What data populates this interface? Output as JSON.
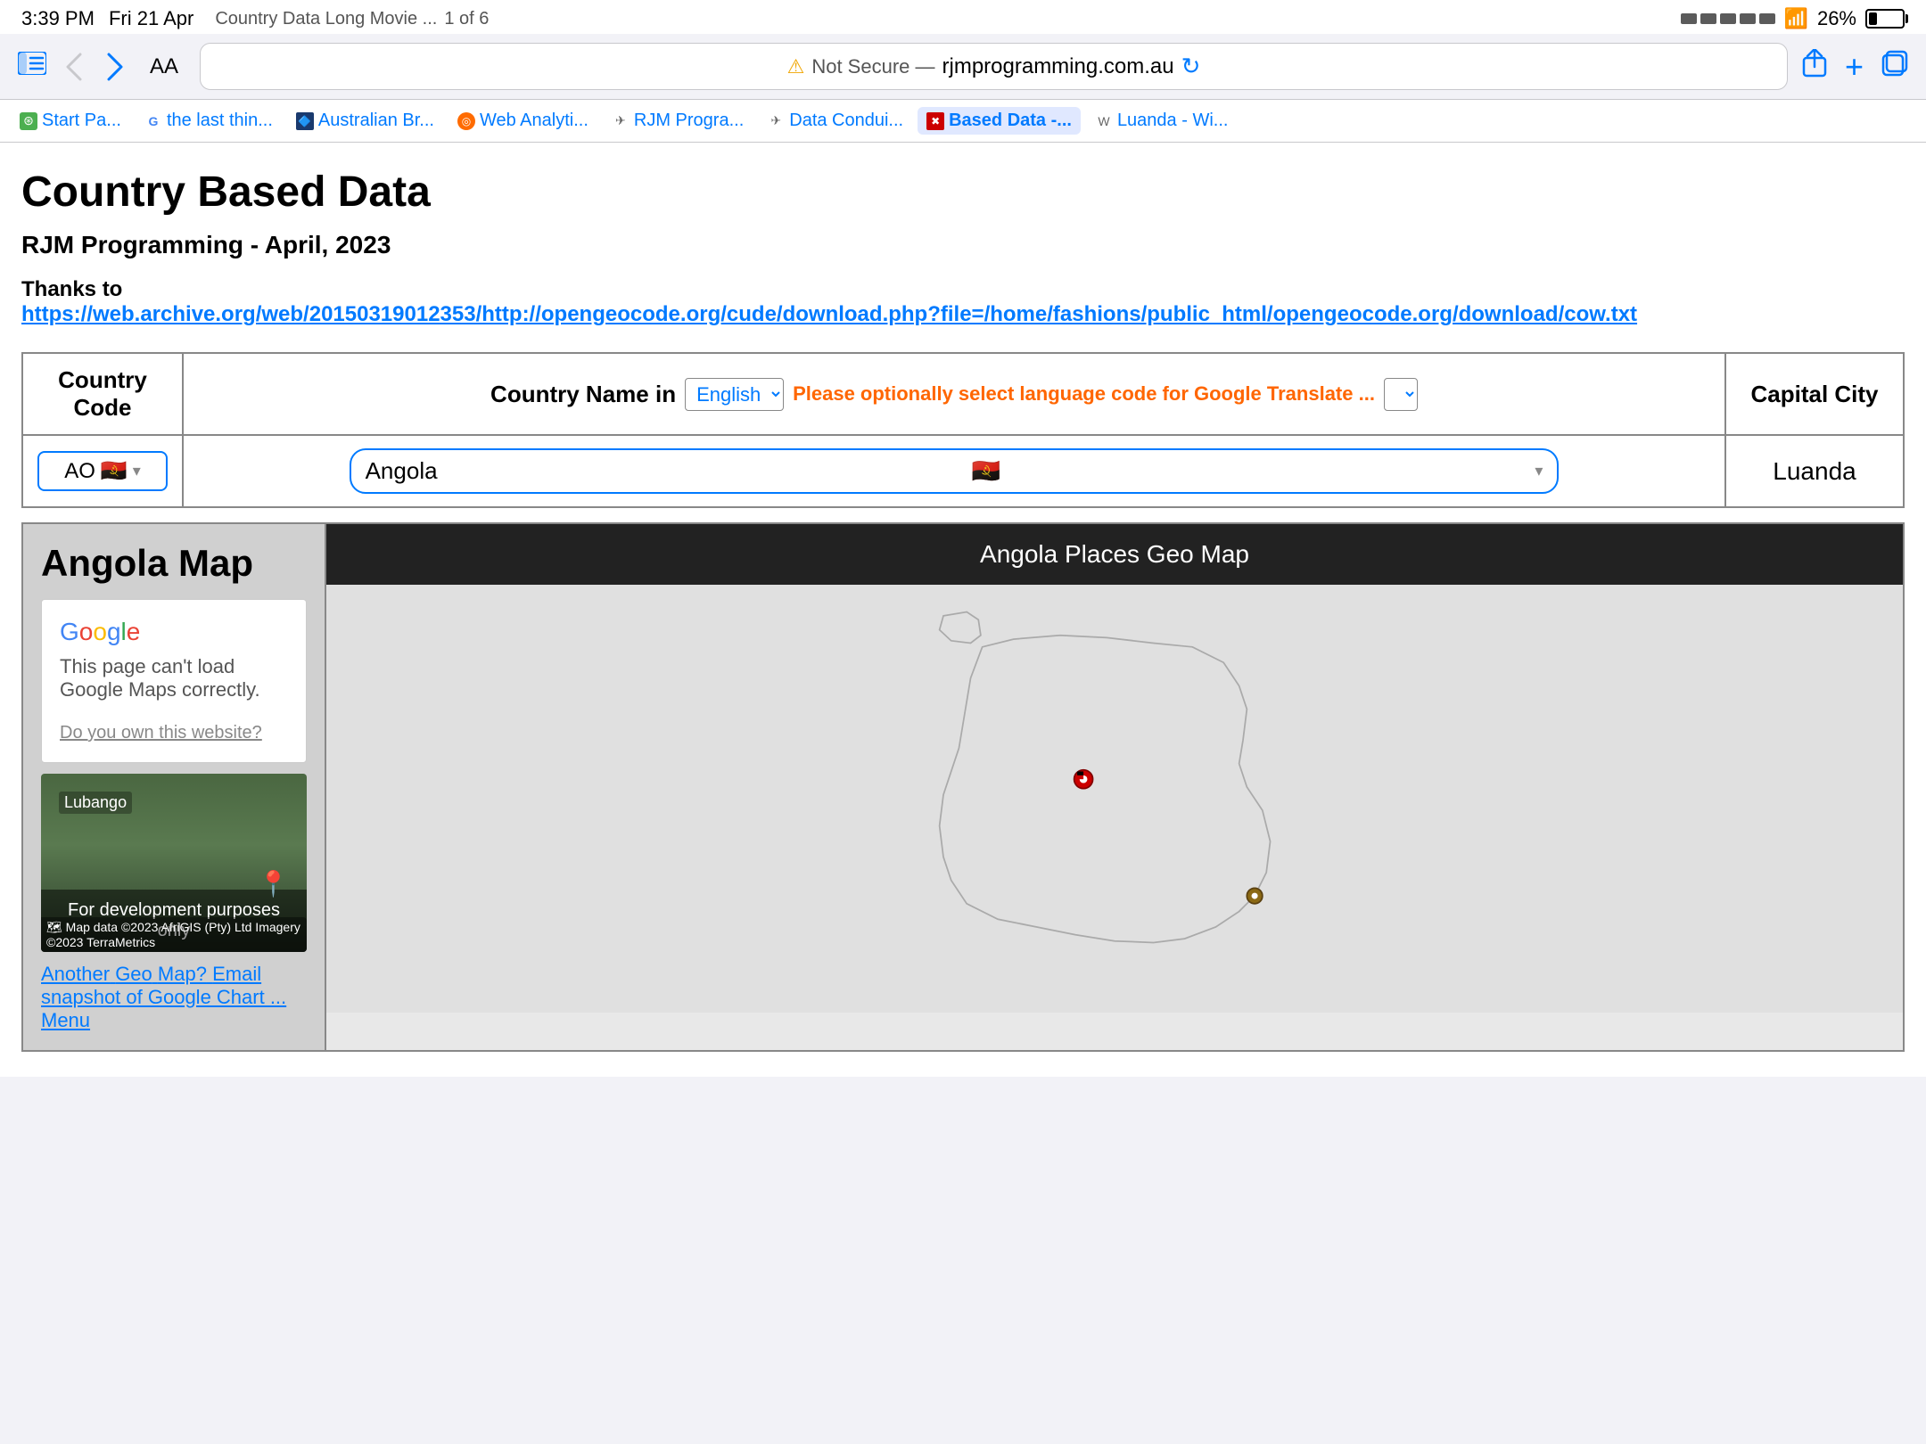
{
  "statusBar": {
    "time": "3:39 PM",
    "date": "Fri 21 Apr",
    "progress": "1 of 6",
    "wifi": "WiFi",
    "batteryPercent": "26%"
  },
  "browser": {
    "addressBar": {
      "notSecure": "Not Secure",
      "url": "rjmprogramming.com.au",
      "separator": "—"
    },
    "bookmarks": [
      {
        "id": "start-page",
        "label": "Start Pa..."
      },
      {
        "id": "google-last",
        "label": "the last thin..."
      },
      {
        "id": "australian-br",
        "label": "Australian Br..."
      },
      {
        "id": "web-analytics",
        "label": "Web Analyti..."
      },
      {
        "id": "rjm-progra",
        "label": "RJM Progra..."
      },
      {
        "id": "data-condui",
        "label": "Data Condui..."
      },
      {
        "id": "based-data",
        "label": "Based Data -...",
        "active": true
      },
      {
        "id": "luanda-wi",
        "label": "Luanda - Wi..."
      }
    ]
  },
  "page": {
    "title": "Country Based Data",
    "subtitle": "RJM Programming - April, 2023",
    "thanksText": "Thanks to",
    "thanksLink": "https://web.archive.org/web/20150319012353/http://opengeocode.org/cude/download.php?file=/home/fashions/public_html/opengeocode.org/download/cow.txt",
    "table": {
      "headers": {
        "countryCode": "Country Code",
        "countryNameIn": "Country Name in",
        "languageEnglish": "English",
        "languageSelectHint": "Please optionally select language code for Google Translate ...",
        "capitalCity": "Capital City"
      },
      "selectedCountryCode": "AO",
      "selectedCountryFlag": "🇦🇴",
      "selectedCountryName": "Angola",
      "selectedCountryNameFlag": "🇦🇴",
      "capitalCity": "Luanda"
    },
    "mapSection": {
      "leftTitle": "Angola Map",
      "googleLogo": "Google",
      "googleErrorMsg": "This page can't load Google Maps correctly.",
      "googleErrorLink": "Do you own this website?",
      "streetMapLabel": "Lubango",
      "streetMapOverlay": "For development purposes only",
      "footerLinks": {
        "another": "Another",
        "geo": "Geo",
        "map": "Map?",
        "email": "Email snapshot of Google Chart ...",
        "menu": "Menu"
      },
      "rightTitle": "Angola Places Geo Map"
    }
  }
}
